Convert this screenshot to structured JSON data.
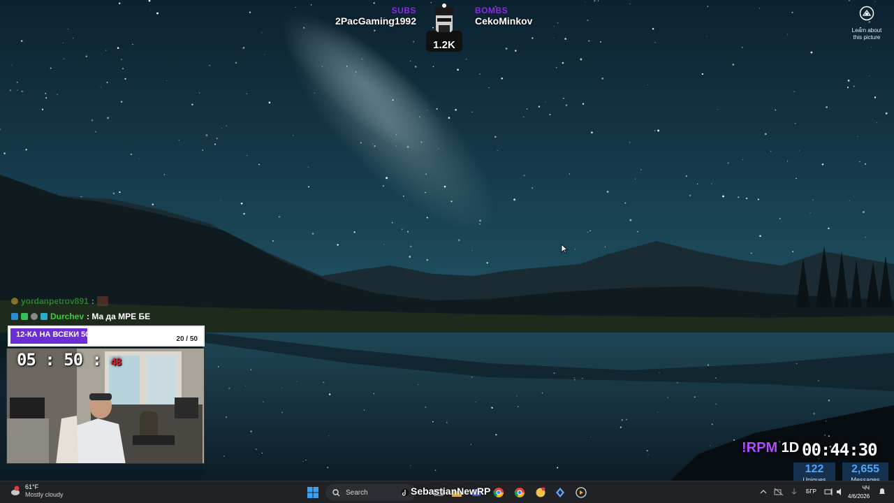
{
  "stream_alert": {
    "left_tag": "SUBS",
    "left_name": "2PacGaming1992",
    "right_tag": "BOMBS",
    "right_name": "CekoMinkov",
    "count": "1.2K"
  },
  "spotlight": {
    "label_line1": "Learn about",
    "label_line2": "this picture"
  },
  "chat": {
    "messages": [
      {
        "user": "yordanpetrov891",
        "text": ":"
      },
      {
        "user": "Durchev",
        "text": ": Ма да МРЕ БЕ"
      }
    ]
  },
  "goal": {
    "label": "12-КА НА ВСЕКИ 50",
    "current": 20,
    "target": 50,
    "count_text": "20 / 50",
    "progress": 0.4
  },
  "webcam": {
    "timer_main": "05 : 50 :",
    "timer_seconds": "48"
  },
  "stream_info": {
    "command": "!RPM",
    "period": "1D",
    "uptime": "00:44:30",
    "uniques_value": "122",
    "uniques_label": "Uniques",
    "messages_value": "2,655",
    "messages_label": "Messages"
  },
  "taskbar": {
    "weather_temp": "61°F",
    "weather_desc": "Mostly cloudy",
    "search_placeholder": "Search",
    "stream_label": "SebastianNewRP",
    "language": "БГР",
    "time": "ЧЧ",
    "date": "4/6/2026"
  },
  "colors": {
    "accent_purple": "#8a2be2",
    "goal_fill": "#6b2fd1",
    "chat_user": "#3cd13c",
    "stat_number": "#4fa3ff",
    "timer_seconds": "#e0202a"
  }
}
